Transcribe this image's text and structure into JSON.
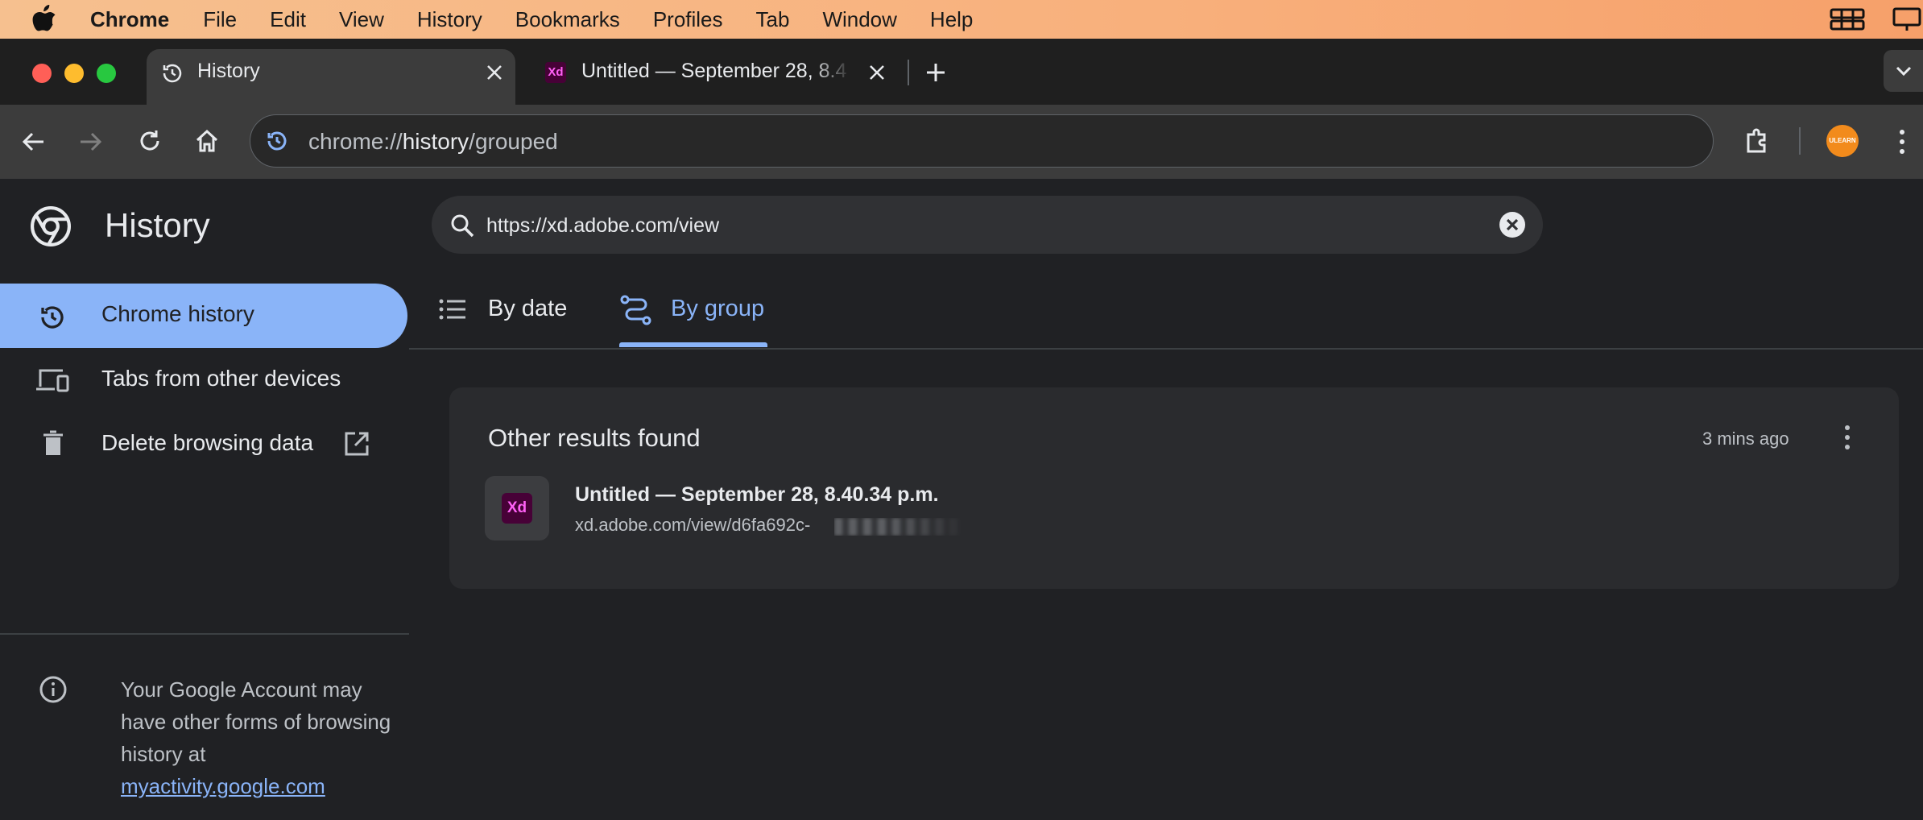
{
  "menubar": {
    "app": "Chrome",
    "items": [
      "File",
      "Edit",
      "View",
      "History",
      "Bookmarks",
      "Profiles",
      "Tab",
      "Window",
      "Help"
    ]
  },
  "tabs": [
    {
      "title": "History",
      "active": true,
      "icon": "history-icon"
    },
    {
      "title": "Untitled — September 28, 8.4",
      "active": false,
      "icon": "adobe-xd-icon",
      "favicon_text": "Xd"
    }
  ],
  "toolbar": {
    "url_prefix": "chrome://",
    "url_host": "history",
    "url_path": "/grouped",
    "avatar_text": "ULEARN"
  },
  "sidebar": {
    "title": "History",
    "items": [
      {
        "label": "Chrome history",
        "icon": "history-icon",
        "active": true
      },
      {
        "label": "Tabs from other devices",
        "icon": "devices-icon",
        "active": false
      },
      {
        "label": "Delete browsing data",
        "icon": "trash-icon",
        "active": false
      }
    ],
    "footer_text": "Your Google Account may have other forms of browsing history at",
    "footer_link": "myactivity.google.com"
  },
  "search": {
    "value": "https://xd.adobe.com/view"
  },
  "view_tabs": [
    {
      "label": "By date",
      "active": false
    },
    {
      "label": "By group",
      "active": true
    }
  ],
  "results": {
    "heading": "Other results found",
    "time": "3 mins ago",
    "entries": [
      {
        "title": "Untitled — September 28, 8.40.34 p.m.",
        "url": "xd.adobe.com/view/d6fa692c-",
        "favicon_text": "Xd"
      }
    ]
  },
  "colors": {
    "accent": "#8ab4f8",
    "xd_magenta": "#ff61f6",
    "xd_bg": "#470137"
  }
}
